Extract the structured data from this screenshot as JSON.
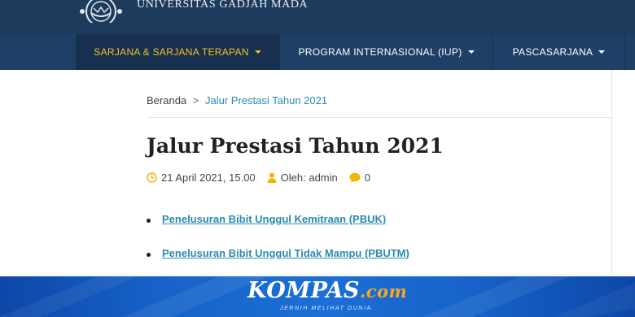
{
  "header": {
    "university_name": "UNIVERSITAS GADJAH MADA",
    "colors": {
      "topbar": "#1e3a5c",
      "navbar": "#1f3f66",
      "active_text": "#f4c12c"
    }
  },
  "nav": {
    "items": [
      {
        "label": "SARJANA & SARJANA TERAPAN",
        "active": true
      },
      {
        "label": "PROGRAM INTERNASIONAL (IUP)",
        "active": false
      },
      {
        "label": "PASCASARJANA",
        "active": false
      }
    ]
  },
  "breadcrumb": {
    "home": "Beranda",
    "separator": ">",
    "current": "Jalur Prestasi Tahun 2021"
  },
  "post": {
    "title": "Jalur Prestasi Tahun 2021",
    "date": "21 April 2021, 15.00",
    "author": "Oleh: admin",
    "comments": "0",
    "links": [
      "Penelusuran Bibit Unggul Kemitraan (PBUK)",
      "Penelusuran Bibit Unggul Tidak Mampu (PBUTM)"
    ],
    "link_color": "#2a8ab0",
    "icon_color": "#f4b400"
  },
  "footer": {
    "brand": "KOMPAS",
    "brand_suffix": ".com",
    "tagline": "JERNIH MELIHAT DUNIA"
  }
}
